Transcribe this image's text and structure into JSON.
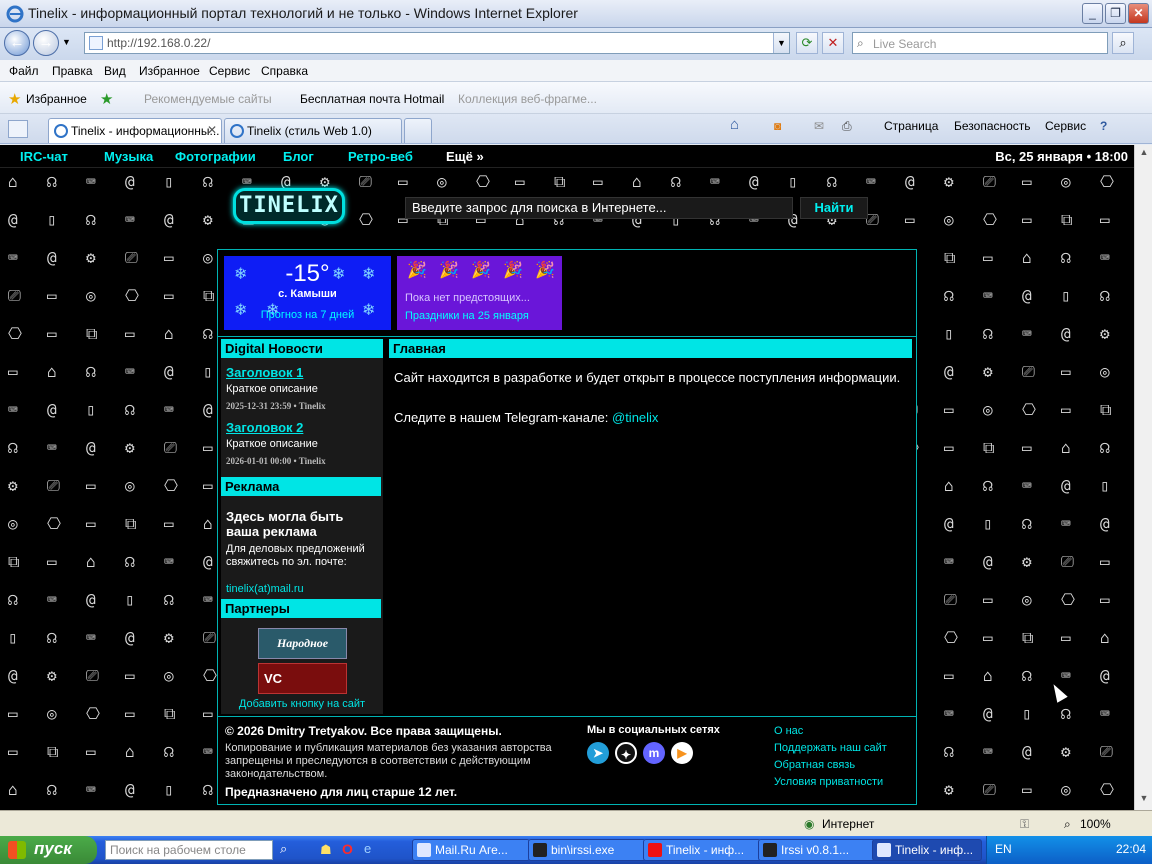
{
  "window": {
    "title": "Tinelix - информационный портал технологий и не только - Windows Internet Explorer",
    "url": "http://192.168.0.22/",
    "search_placeholder": "Live Search"
  },
  "menu": [
    "Файл",
    "Правка",
    "Вид",
    "Избранное",
    "Сервис",
    "Справка"
  ],
  "favorites_bar": {
    "favorites": "Избранное",
    "recommended": "Рекомендуемые сайты",
    "hotmail": "Бесплатная почта Hotmail",
    "webslices": "Коллекция веб-фрагме..."
  },
  "tabs": [
    {
      "label": "Tinelix - информационны..."
    },
    {
      "label": "Tinelix (стиль Web 1.0)"
    }
  ],
  "commands": {
    "page": "Страница",
    "safety": "Безопасность",
    "tools": "Сервис"
  },
  "site": {
    "nav": [
      "IRC-чат",
      "Музыка",
      "Фотографии",
      "Блог",
      "Ретро-веб",
      "Ещё »"
    ],
    "date": "Вс, 25 января • 18:00",
    "logo": "TINELIX",
    "search_placeholder": "Введите запрос для поиска в Интернете...",
    "search_button": "Найти",
    "weather": {
      "temp": "-15°",
      "city": "с. Камыши",
      "forecast": "Прогноз на 7 дней"
    },
    "holidays": {
      "none": "Пока нет предстоящих...",
      "link": "Праздники на 25 января"
    },
    "news": {
      "heading": "Digital Новости",
      "items": [
        {
          "title": "Заголовок 1",
          "desc": "Краткое описание",
          "meta": "2025-12-31 23:59 • Tinelix"
        },
        {
          "title": "Заголовок 2",
          "desc": "Краткое описание",
          "meta": "2026-01-01 00:00 • Tinelix"
        }
      ]
    },
    "ads": {
      "heading": "Реклама",
      "title": "Здесь могла быть ваша реклама",
      "text": "Для деловых предложений свяжитесь по эл. почте:",
      "email": "tinelix(at)mail.ru"
    },
    "partners": {
      "heading": "Партнеры",
      "p1": "Народное",
      "p2": "VC",
      "add": "Добавить кнопку на сайт"
    },
    "main": {
      "heading": "Главная",
      "p1": "Сайт находится в разработке и будет открыт в процессе поступления информации.",
      "p2_prefix": "Следите в нашем Telegram-канале: ",
      "p2_link": "@tinelix"
    },
    "footer": {
      "copyright": "© 2026 Dmitry Tretyakov. Все права защищены.",
      "legal": "Копирование и публикация материалов без указания авторства запрещены и преследуются в соответствии с действующим законодательством.",
      "age": "Предназначено для лиц старше 12 лет.",
      "social_title": "Мы в социальных сетях",
      "links": [
        "О нас",
        "Поддержать наш сайт",
        "Обратная связь",
        "Условия приватности"
      ]
    }
  },
  "statusbar": {
    "zone": "Интернет",
    "zoom": "100%"
  },
  "taskbar": {
    "start": "пуск",
    "search_placeholder": "Поиск на рабочем столе",
    "tasks": [
      "Mail.Ru Аге...",
      "bin\\irssi.exe",
      "Tinelix - инф...",
      "Irssi v0.8.1...",
      "Tinelix - инф..."
    ],
    "lang": "EN",
    "clock": "22:04"
  }
}
